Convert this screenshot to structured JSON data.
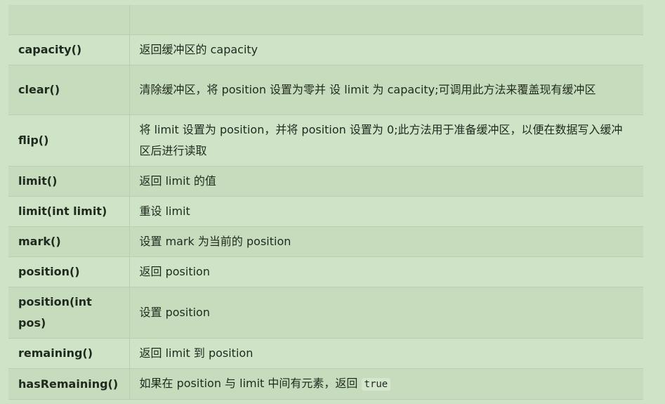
{
  "table": {
    "rows": [
      {
        "method": "capacity()",
        "description": "返回缓冲区的 capacity"
      },
      {
        "method": "clear()",
        "description": "清除缓冲区，将 position 设置为零并 设 limit 为 capacity;可调用此方法来覆盖现有缓冲区"
      },
      {
        "method": "flip()",
        "description": "将 limit 设置为 position，并将 position 设置为 0;此方法用于准备缓冲区，以便在数据写入缓冲区后进行读取"
      },
      {
        "method": "limit()",
        "description": "返回 limit 的值"
      },
      {
        "method": "limit(int limit)",
        "description": "重设 limit"
      },
      {
        "method": "mark()",
        "description": "设置 mark 为当前的 position"
      },
      {
        "method": "position()",
        "description": "返回 position"
      },
      {
        "method": "position(int pos)",
        "description": "设置 position"
      },
      {
        "method": "remaining()",
        "description": "返回 limit 到 position"
      },
      {
        "method": "hasRemaining()",
        "description_prefix": "如果在 position 与 limit 中间有元素，返回 ",
        "description_code": "true"
      }
    ]
  }
}
